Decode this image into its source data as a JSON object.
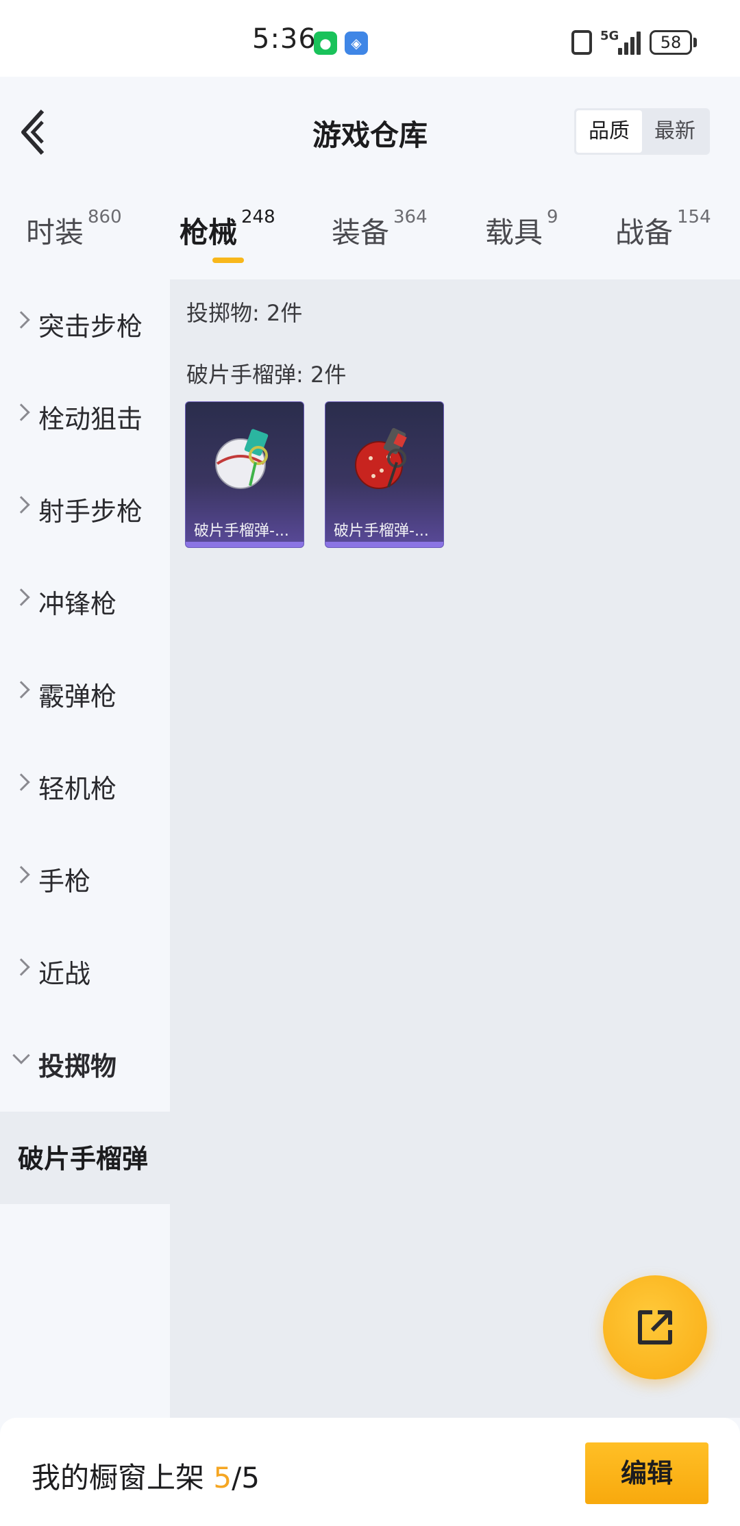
{
  "status_bar": {
    "time": "5:36",
    "network": "5G",
    "battery": "58"
  },
  "header": {
    "title": "游戏仓库",
    "sort_options": [
      "品质",
      "最新"
    ]
  },
  "tabs": [
    {
      "label": "时装",
      "count": "860"
    },
    {
      "label": "枪械",
      "count": "248"
    },
    {
      "label": "装备",
      "count": "364"
    },
    {
      "label": "载具",
      "count": "9"
    },
    {
      "label": "战备",
      "count": "154"
    }
  ],
  "sidebar": {
    "items": [
      "突击步枪",
      "栓动狙击",
      "射手步枪",
      "冲锋枪",
      "霰弹枪",
      "轻机枪",
      "手枪",
      "近战",
      "投掷物"
    ],
    "selected_sub": "破片手榴弹"
  },
  "content": {
    "category_summary": "投掷物: 2件",
    "subcategory_summary": "破片手榴弹: 2件",
    "items": [
      {
        "name": "破片手榴弹-...",
        "color_main": "#e9e9ee",
        "color_accent": "#2bb5a0"
      },
      {
        "name": "破片手榴弹-...",
        "color_main": "#c8241f",
        "color_accent": "#555555"
      }
    ]
  },
  "bottom_bar": {
    "label": "我的橱窗上架",
    "count_current": "5",
    "count_total": "/5",
    "edit_label": "编辑"
  },
  "icons": {
    "back": "chevron-left-icon",
    "share": "share-external-icon",
    "expand": "chevron-right-icon",
    "collapse": "chevron-down-icon"
  }
}
